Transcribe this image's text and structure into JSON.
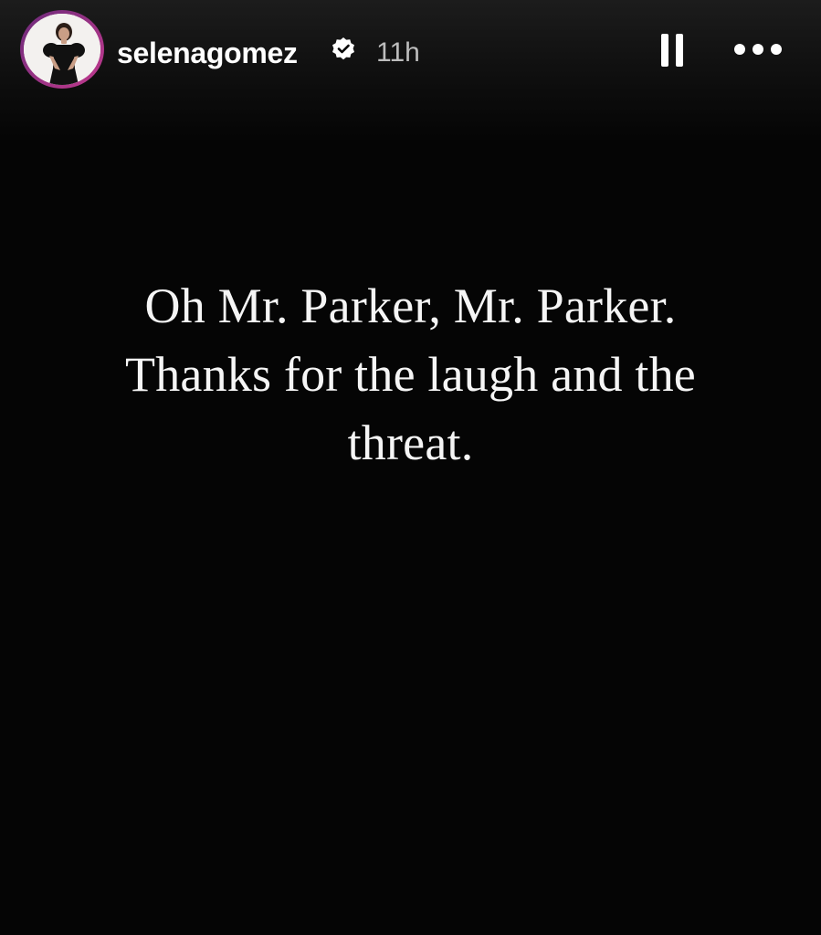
{
  "header": {
    "username": "selenagomez",
    "time_ago": "11h",
    "avatar_icon": "profile-avatar",
    "verified_icon": "verified-badge-icon",
    "pause_icon": "pause-icon",
    "more_icon": "more-options-icon"
  },
  "story": {
    "lines": [
      "Oh Mr. Parker, Mr. Parker.",
      "Thanks for the laugh and the",
      "threat."
    ]
  },
  "colors": {
    "background": "#050505",
    "text": "#f5f5f5",
    "avatar_ring": "#c33a8e",
    "muted": "#bdbdbd"
  }
}
